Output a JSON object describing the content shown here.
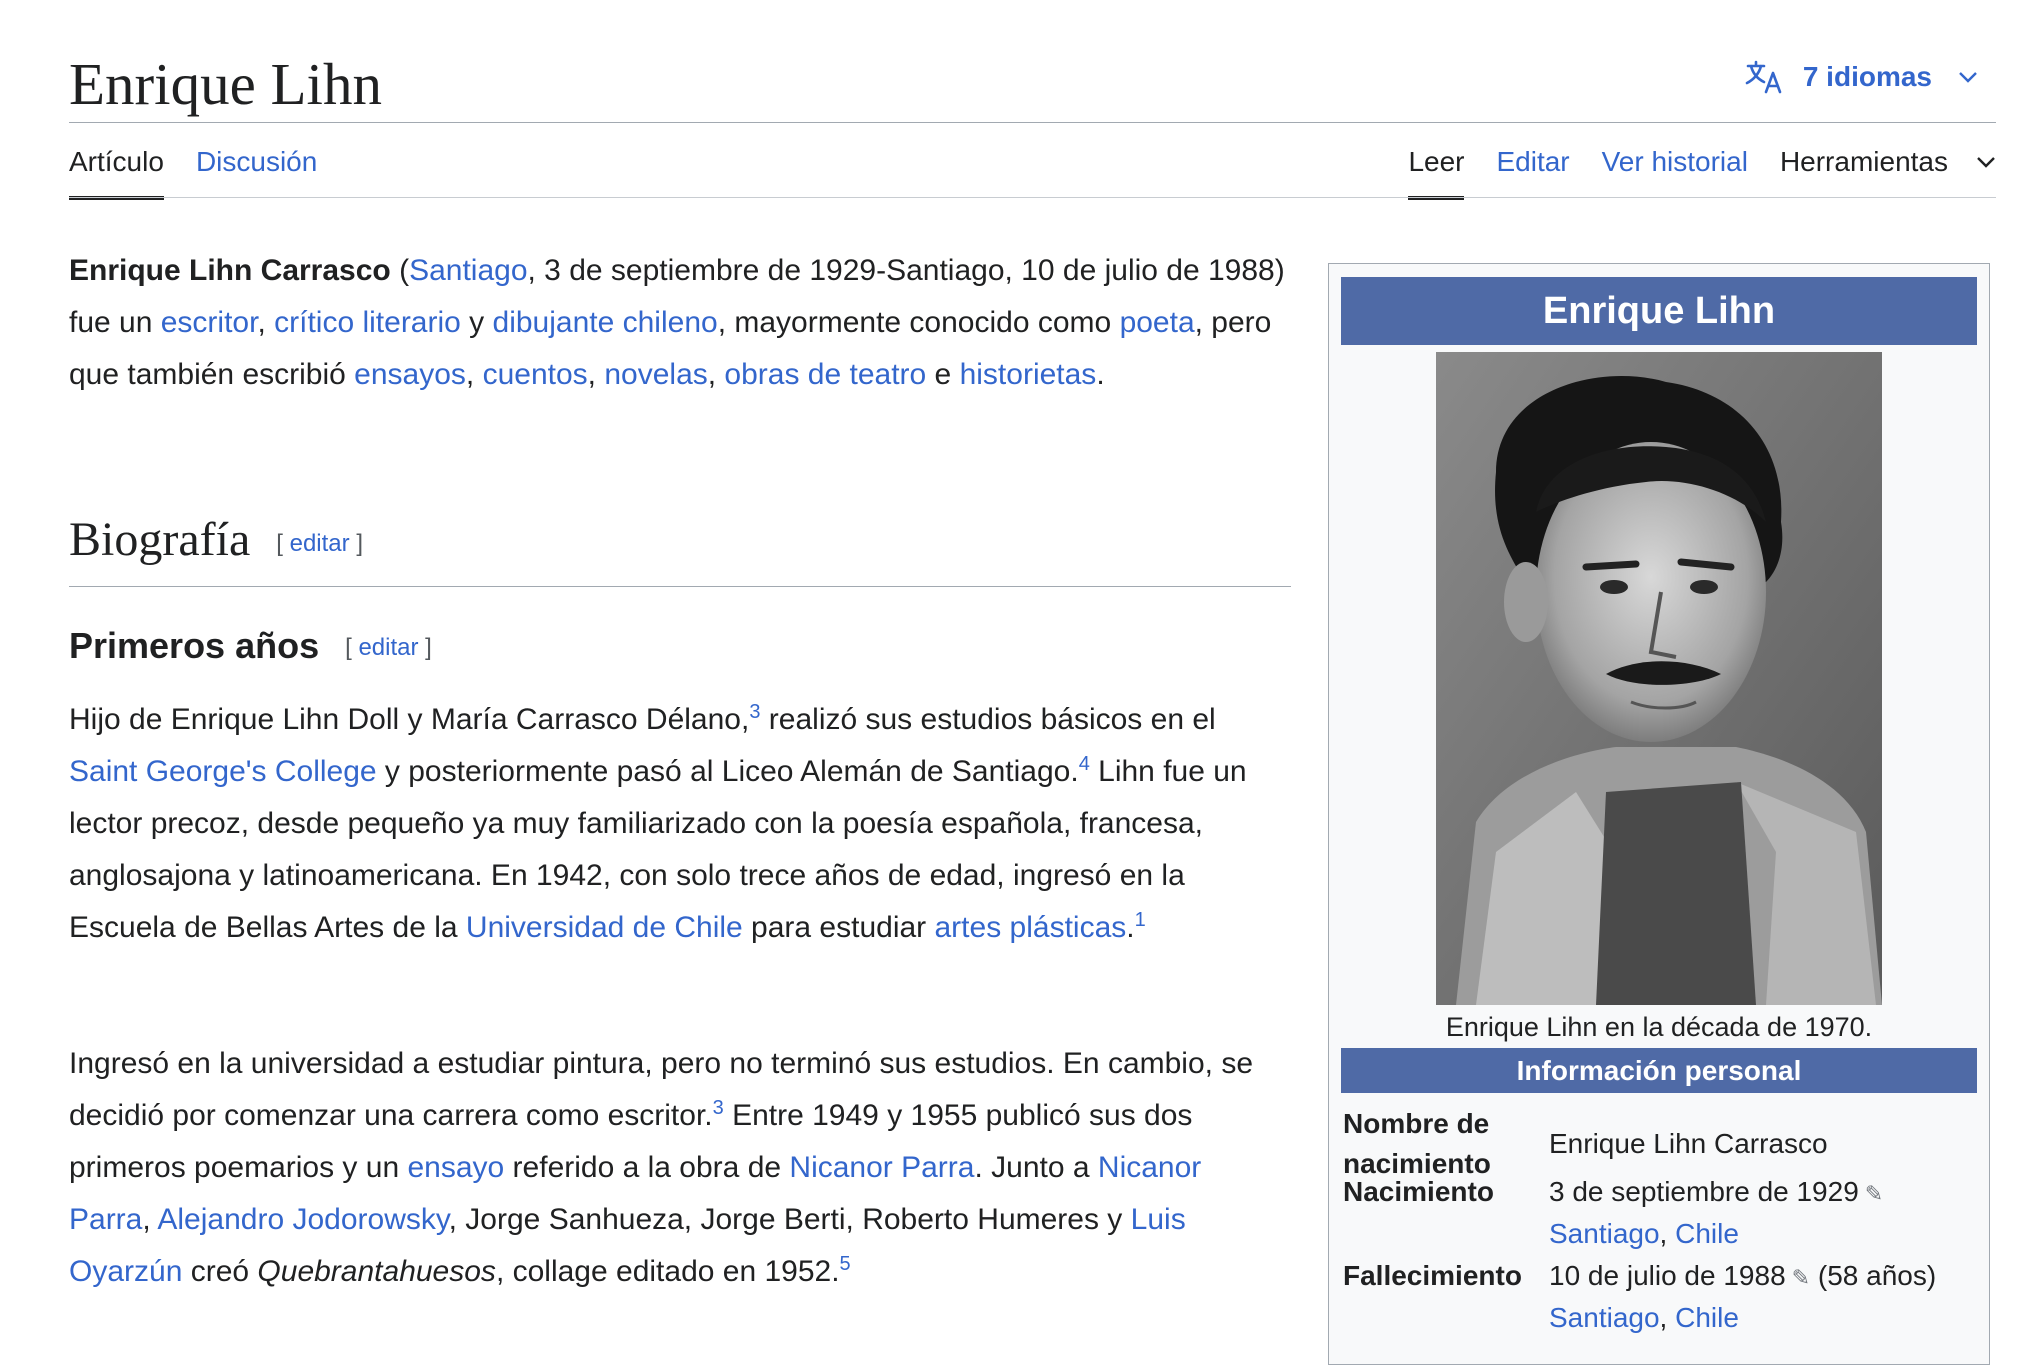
{
  "page": {
    "title": "Enrique Lihn",
    "languages_label": "7 idiomas"
  },
  "tabs_left": [
    "Artículo",
    "Discusión"
  ],
  "tabs_right": [
    "Leer",
    "Editar",
    "Ver historial",
    "Herramientas"
  ],
  "intro": {
    "name_bold": "Enrique Lihn Carrasco",
    "t1": " (",
    "l_santiago": "Santiago",
    "t2": ", 3 de septiembre de 1929-Santiago, 10 de julio de 1988) fue un ",
    "l_escritor": "escritor",
    "t3": ", ",
    "l_critico": "crítico literario",
    "t4": " y ",
    "l_dibujante": "dibujante chileno",
    "t5": ", mayormente conocido como ",
    "l_poeta": "poeta",
    "t6": ", pero que también escribió ",
    "l_ensayos": "ensayos",
    "t7": ", ",
    "l_cuentos": "cuentos",
    "t8": ", ",
    "l_novelas": "novelas",
    "t9": ", ",
    "l_obras": "obras de teatro",
    "t10": " e ",
    "l_historietas": "historietas",
    "t11": "."
  },
  "section": {
    "biografia": "Biografía",
    "edit_open": "[ ",
    "edit_label": "editar",
    "edit_close": " ]",
    "primeros": "Primeros años"
  },
  "para1": {
    "t1": "Hijo de Enrique Lihn Doll y María Carrasco Délano,",
    "ref1": "3",
    "t2": "  realizó sus estudios básicos en el ",
    "l_college": "Saint George's College",
    "t3": " y posteriormente pasó al Liceo Alemán de Santiago.",
    "ref2": "4",
    "t4": "  Lihn fue un lector precoz, desde pequeño ya muy familiarizado con la poesía española, francesa, anglosajona y latinoamericana. En 1942, con solo trece años de edad, ingresó en la Escuela de Bellas Artes de la ",
    "l_uchile": "Universidad de Chile",
    "t5": " para estudiar ",
    "l_artes": "artes plásticas",
    "t6": ".",
    "ref3": "1"
  },
  "para2": {
    "t1": "Ingresó en la universidad a estudiar pintura, pero no terminó sus estudios. En cambio, se decidió por comenzar una carrera como escritor.",
    "ref1": "3",
    "t2": "  Entre 1949 y 1955 publicó sus dos primeros poemarios y un ",
    "l_ensayo": "ensayo",
    "t3": " referido a la obra de ",
    "l_parra1": "Nicanor Parra",
    "t4": ". Junto a ",
    "l_parra2": "Nicanor Parra",
    "t5": ", ",
    "l_jodo": "Alejandro Jodorowsky",
    "t6": ", Jorge Sanhueza, Jorge Berti, Roberto Humeres y ",
    "l_oyarzun": "Luis Oyarzún",
    "t7": " creó ",
    "em_quebranta": "Quebrantahuesos",
    "t8": ", collage editado en 1952.",
    "ref2": "5"
  },
  "infobox": {
    "title": "Enrique Lihn",
    "caption": "Enrique Lihn en la década de 1970.",
    "section": "Información personal",
    "rows": [
      {
        "label": "Nombre de nacimiento",
        "value": "Enrique Lihn Carrasco"
      },
      {
        "label": "Nacimiento",
        "value": "3 de septiembre de 1929",
        "place": "Santiago",
        "sep": ", ",
        "country": "Chile"
      },
      {
        "label": "Fallecimiento",
        "value": "10 de julio de 1988",
        "extra": " (58 años)",
        "place": "Santiago",
        "sep": ", ",
        "country": "Chile"
      }
    ]
  },
  "colors": {
    "link": "#3366cc",
    "infobox_header": "#4f6aa6",
    "text": "#202122"
  }
}
